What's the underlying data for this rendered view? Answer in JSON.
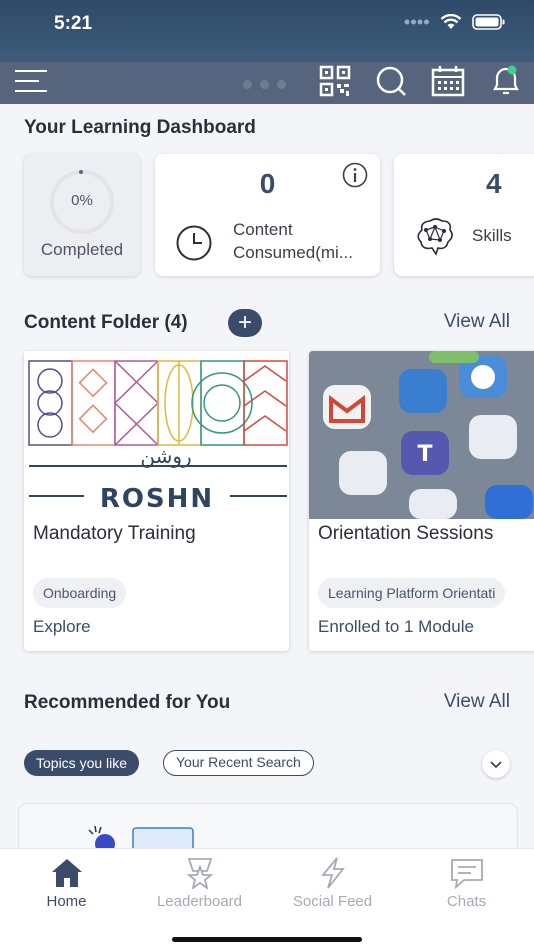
{
  "status": {
    "time": "5:21"
  },
  "dashboard": {
    "title": "Your Learning Dashboard",
    "completed_value": "0%",
    "completed_label": "Completed",
    "consumed_value": "0",
    "consumed_label": "Content Consumed(mi...",
    "skills_value": "4",
    "skills_label": "Skills"
  },
  "content_folder": {
    "title": "Content Folder (4)",
    "view_all": "View All",
    "folders": [
      {
        "title": "Mandatory Training",
        "tag": "Onboarding",
        "subtitle": "Explore",
        "logo_text": "ROSHN",
        "logo_arabic": "روشن"
      },
      {
        "title": "Orientation Sessions",
        "tag": "Learning Platform Orientati",
        "subtitle": "Enrolled to 1 Module"
      }
    ]
  },
  "recommended": {
    "title": "Recommended for You",
    "view_all": "View All",
    "chips": [
      "Topics you like",
      "Your Recent Search"
    ]
  },
  "bottom_nav": [
    {
      "label": "Home",
      "icon": "home-icon",
      "active": true
    },
    {
      "label": "Leaderboard",
      "icon": "trophy-icon",
      "active": false
    },
    {
      "label": "Social Feed",
      "icon": "lightning-icon",
      "active": false
    },
    {
      "label": "Chats",
      "icon": "chat-icon",
      "active": false
    }
  ],
  "colors": {
    "primary": "#3b4c6b",
    "header": "#56657d",
    "notification_dot": "#3ecf8e"
  }
}
